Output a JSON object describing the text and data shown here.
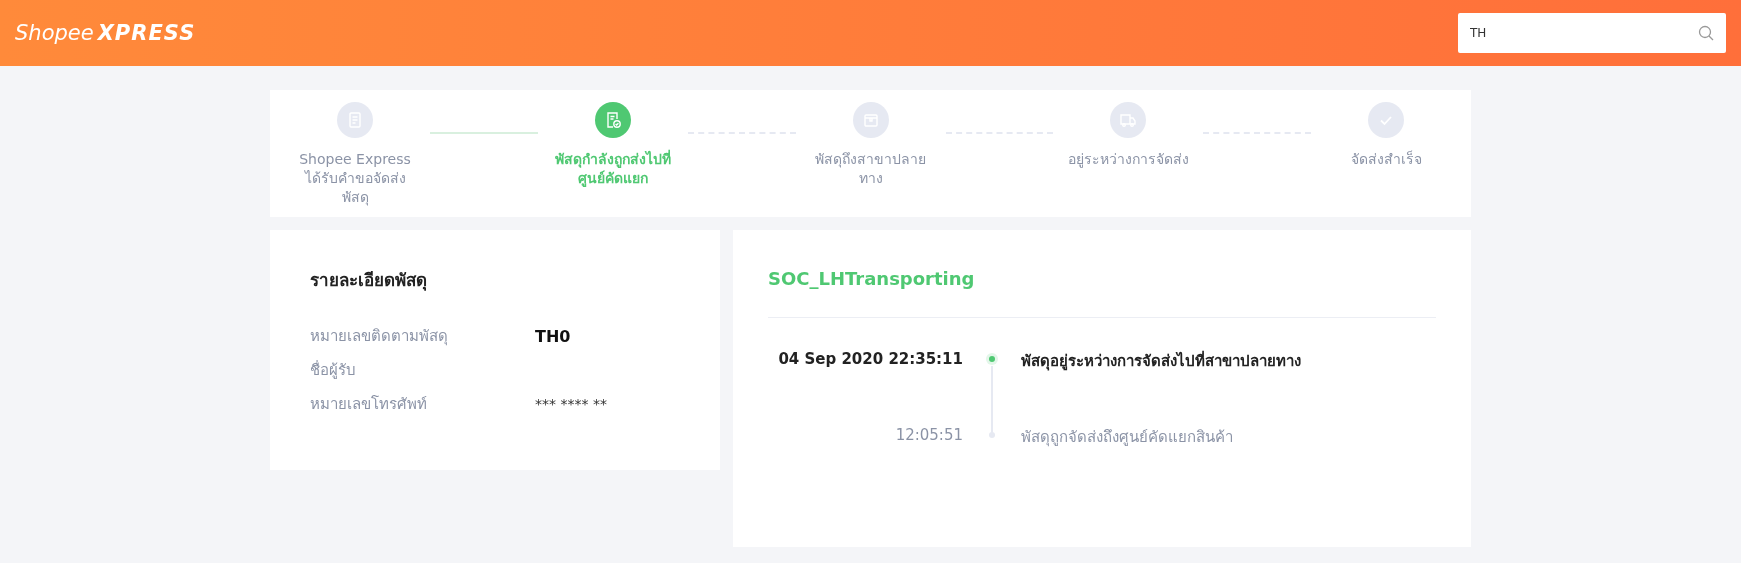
{
  "header": {
    "logo": {
      "first": "Shopee",
      "second": "XPRESS"
    },
    "search": {
      "value": "TH"
    }
  },
  "steps": [
    {
      "label": "Shopee Express ได้รับคำขอจัดส่งพัสดุ",
      "selected": false,
      "kind": "document"
    },
    {
      "label": "พัสดุกำลังถูกส่งไปที่ศูนย์คัดแยก",
      "selected": true,
      "kind": "document-check"
    },
    {
      "label": "พัสดุถึงสาขาปลายทาง",
      "selected": false,
      "kind": "box"
    },
    {
      "label": "อยู่ระหว่างการจัดส่ง",
      "selected": false,
      "kind": "truck"
    },
    {
      "label": "จัดส่งสำเร็จ",
      "selected": false,
      "kind": "check"
    }
  ],
  "details": {
    "title": "รายละเอียดพัสดุ",
    "rows": [
      {
        "label": "หมายเลขติดตามพัสดุ",
        "value": "TH0",
        "bold": true
      },
      {
        "label": "ชื่อผู้รับ"
      },
      {
        "label": "หมายเลขโทรศัพท์",
        "value": "*** **** **",
        "bold": false
      }
    ]
  },
  "tracking": {
    "status": "SOC_LHTransporting",
    "events": [
      {
        "time": "04 Sep 2020 22:35:11",
        "text": "พัสดุอยู่ระหว่างการจัดส่งไปที่สาขาปลายทาง",
        "selected": true
      },
      {
        "time": "12:05:51",
        "text": "พัสดุถูกจัดส่งถึงศูนย์คัดแยกสินค้า",
        "selected": false
      }
    ]
  }
}
